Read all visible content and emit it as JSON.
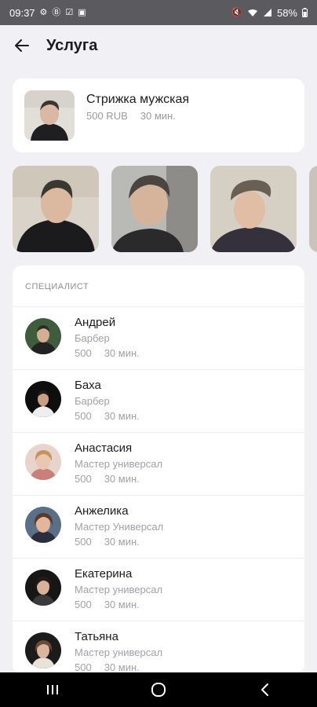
{
  "status_bar": {
    "time": "09:37",
    "battery": "58%",
    "left_icons": [
      "gear-icon",
      "b-icon",
      "check-icon",
      "image-icon"
    ],
    "right_icons": [
      "mute-icon",
      "wifi-icon",
      "signal-icon",
      "battery-icon"
    ]
  },
  "header": {
    "title": "Услуга",
    "back_icon": "arrow-left-icon"
  },
  "service": {
    "name": "Стрижка мужская",
    "price": "500 RUB",
    "duration": "30 мин."
  },
  "gallery": {
    "photos": [
      "haircut-photo-1",
      "haircut-photo-2",
      "haircut-photo-3",
      "haircut-photo-4"
    ]
  },
  "specialists": {
    "title": "СПЕЦИАЛИСТ",
    "items": [
      {
        "name": "Андрей",
        "role": "Барбер",
        "price": "500",
        "duration": "30 мин."
      },
      {
        "name": "Баха",
        "role": "Барбер",
        "price": "500",
        "duration": "30 мин."
      },
      {
        "name": "Анастасия",
        "role": "Мастер универсал",
        "price": "500",
        "duration": "30 мин."
      },
      {
        "name": "Анжелика",
        "role": "Мастер Универсал",
        "price": "500",
        "duration": "30 мин."
      },
      {
        "name": "Екатерина",
        "role": "Мастер универсал",
        "price": "500",
        "duration": "30 мин."
      },
      {
        "name": "Татьяна",
        "role": "Мастер универсал",
        "price": "500",
        "duration": "30 мин."
      }
    ]
  },
  "nav_bar": {
    "buttons": [
      "recent-apps-icon",
      "home-icon",
      "back-icon"
    ]
  }
}
